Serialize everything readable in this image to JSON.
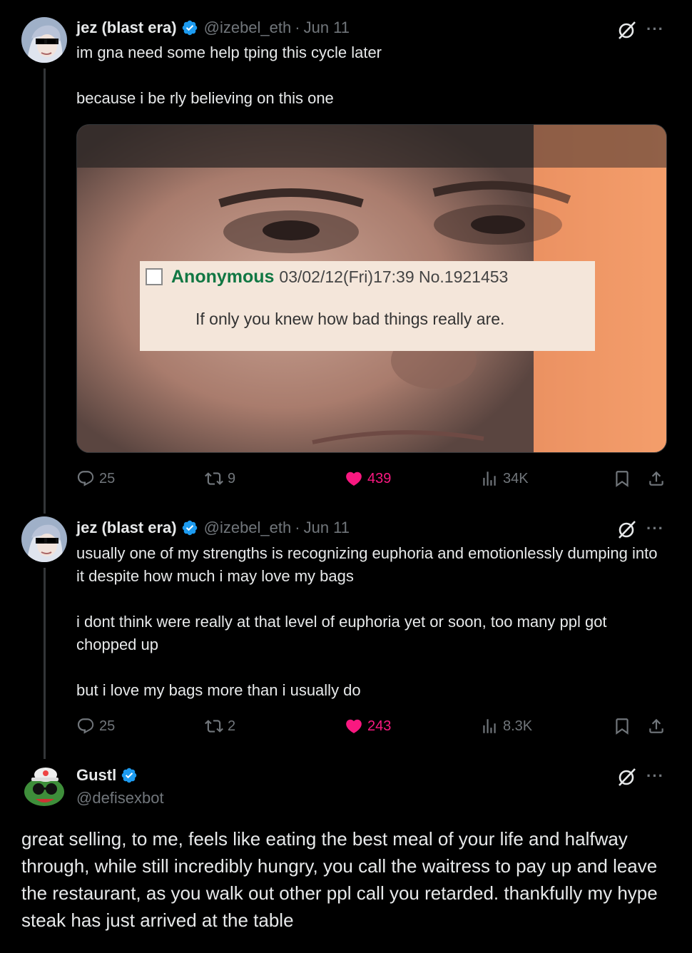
{
  "colors": {
    "background": "#000000",
    "text": "#e7e9ea",
    "muted": "#71767b",
    "like": "#f91880",
    "verified": "#1d9bf0"
  },
  "tweets": [
    {
      "name": "jez (blast era)",
      "handle": "@izebel_eth",
      "sep": "·",
      "date": "Jun 11",
      "text": "im gna need some help tping this cycle later\n\nbecause i be rly believing on this one",
      "media": {
        "poster": "Anonymous",
        "meta": "03/02/12(Fri)17:39 No.1921453",
        "message": "If only you knew how bad things really are."
      },
      "stats": {
        "replies": "25",
        "reposts": "9",
        "likes": "439",
        "views": "34K"
      }
    },
    {
      "name": "jez (blast era)",
      "handle": "@izebel_eth",
      "sep": "·",
      "date": "Jun 11",
      "text": "usually one of my strengths is recognizing euphoria and emotionlessly dumping into it despite how much i may love my bags\n\ni dont think were really at that level of euphoria yet or soon, too many ppl got chopped up\n\nbut i love my bags more than i usually do",
      "stats": {
        "replies": "25",
        "reposts": "2",
        "likes": "243",
        "views": "8.3K"
      }
    },
    {
      "name": "Gustl",
      "handle": "@defisexbot",
      "text": "great selling, to me, feels like eating the best meal of your life and halfway through, while still incredibly hungry, you call the waitress to pay up and leave the restaurant, as you walk out other ppl call you retarded. thankfully my hype steak has just arrived at the table"
    }
  ],
  "icons": {
    "more": "···",
    "verified": "verified-badge-icon",
    "grok": "grok-icon",
    "reply": "reply-icon",
    "repost": "repost-icon",
    "like": "heart-icon",
    "views": "views-icon",
    "bookmark": "bookmark-icon",
    "share": "share-icon"
  }
}
